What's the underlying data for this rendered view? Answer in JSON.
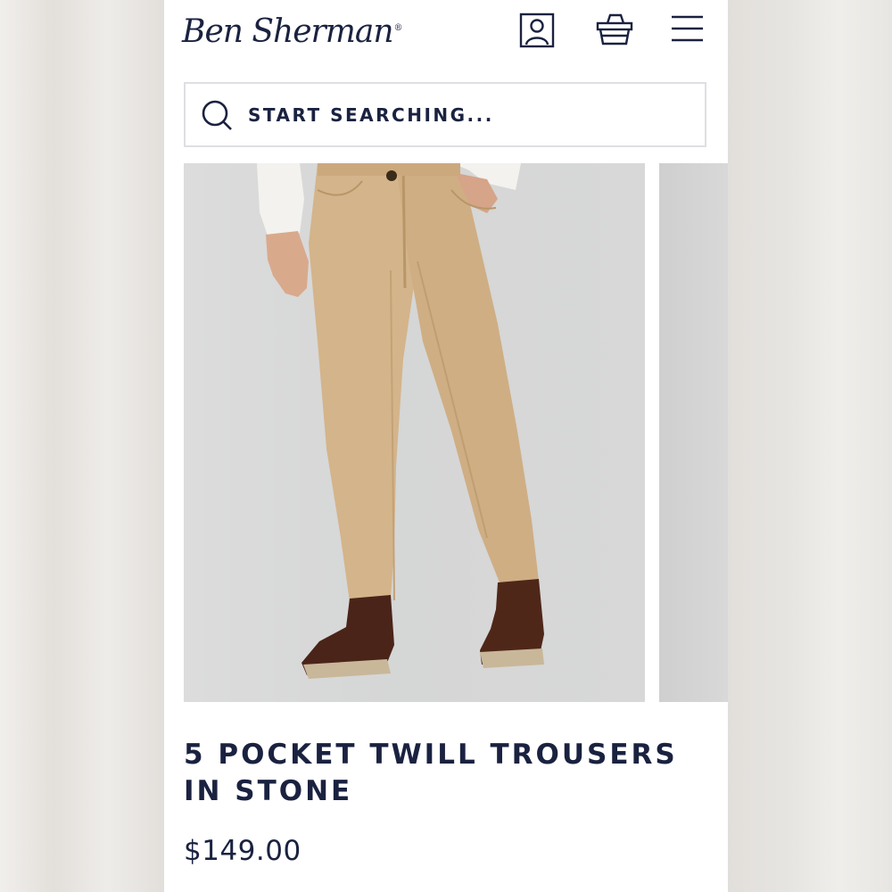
{
  "header": {
    "brand": "Ben Sherman",
    "brand_mark": "®",
    "icons": [
      "account-icon",
      "basket-icon",
      "menu-icon"
    ]
  },
  "search": {
    "placeholder": "START SEARCHING...",
    "icon": "search-icon"
  },
  "product": {
    "title": "5 POCKET TWILL TROUSERS IN STONE",
    "price": "$149.00",
    "image": "product-photo-stone-trousers"
  },
  "colors": {
    "brand_navy": "#1a2240",
    "trousers_stone": "#d4b48a",
    "boots_brown": "#4a2418"
  }
}
